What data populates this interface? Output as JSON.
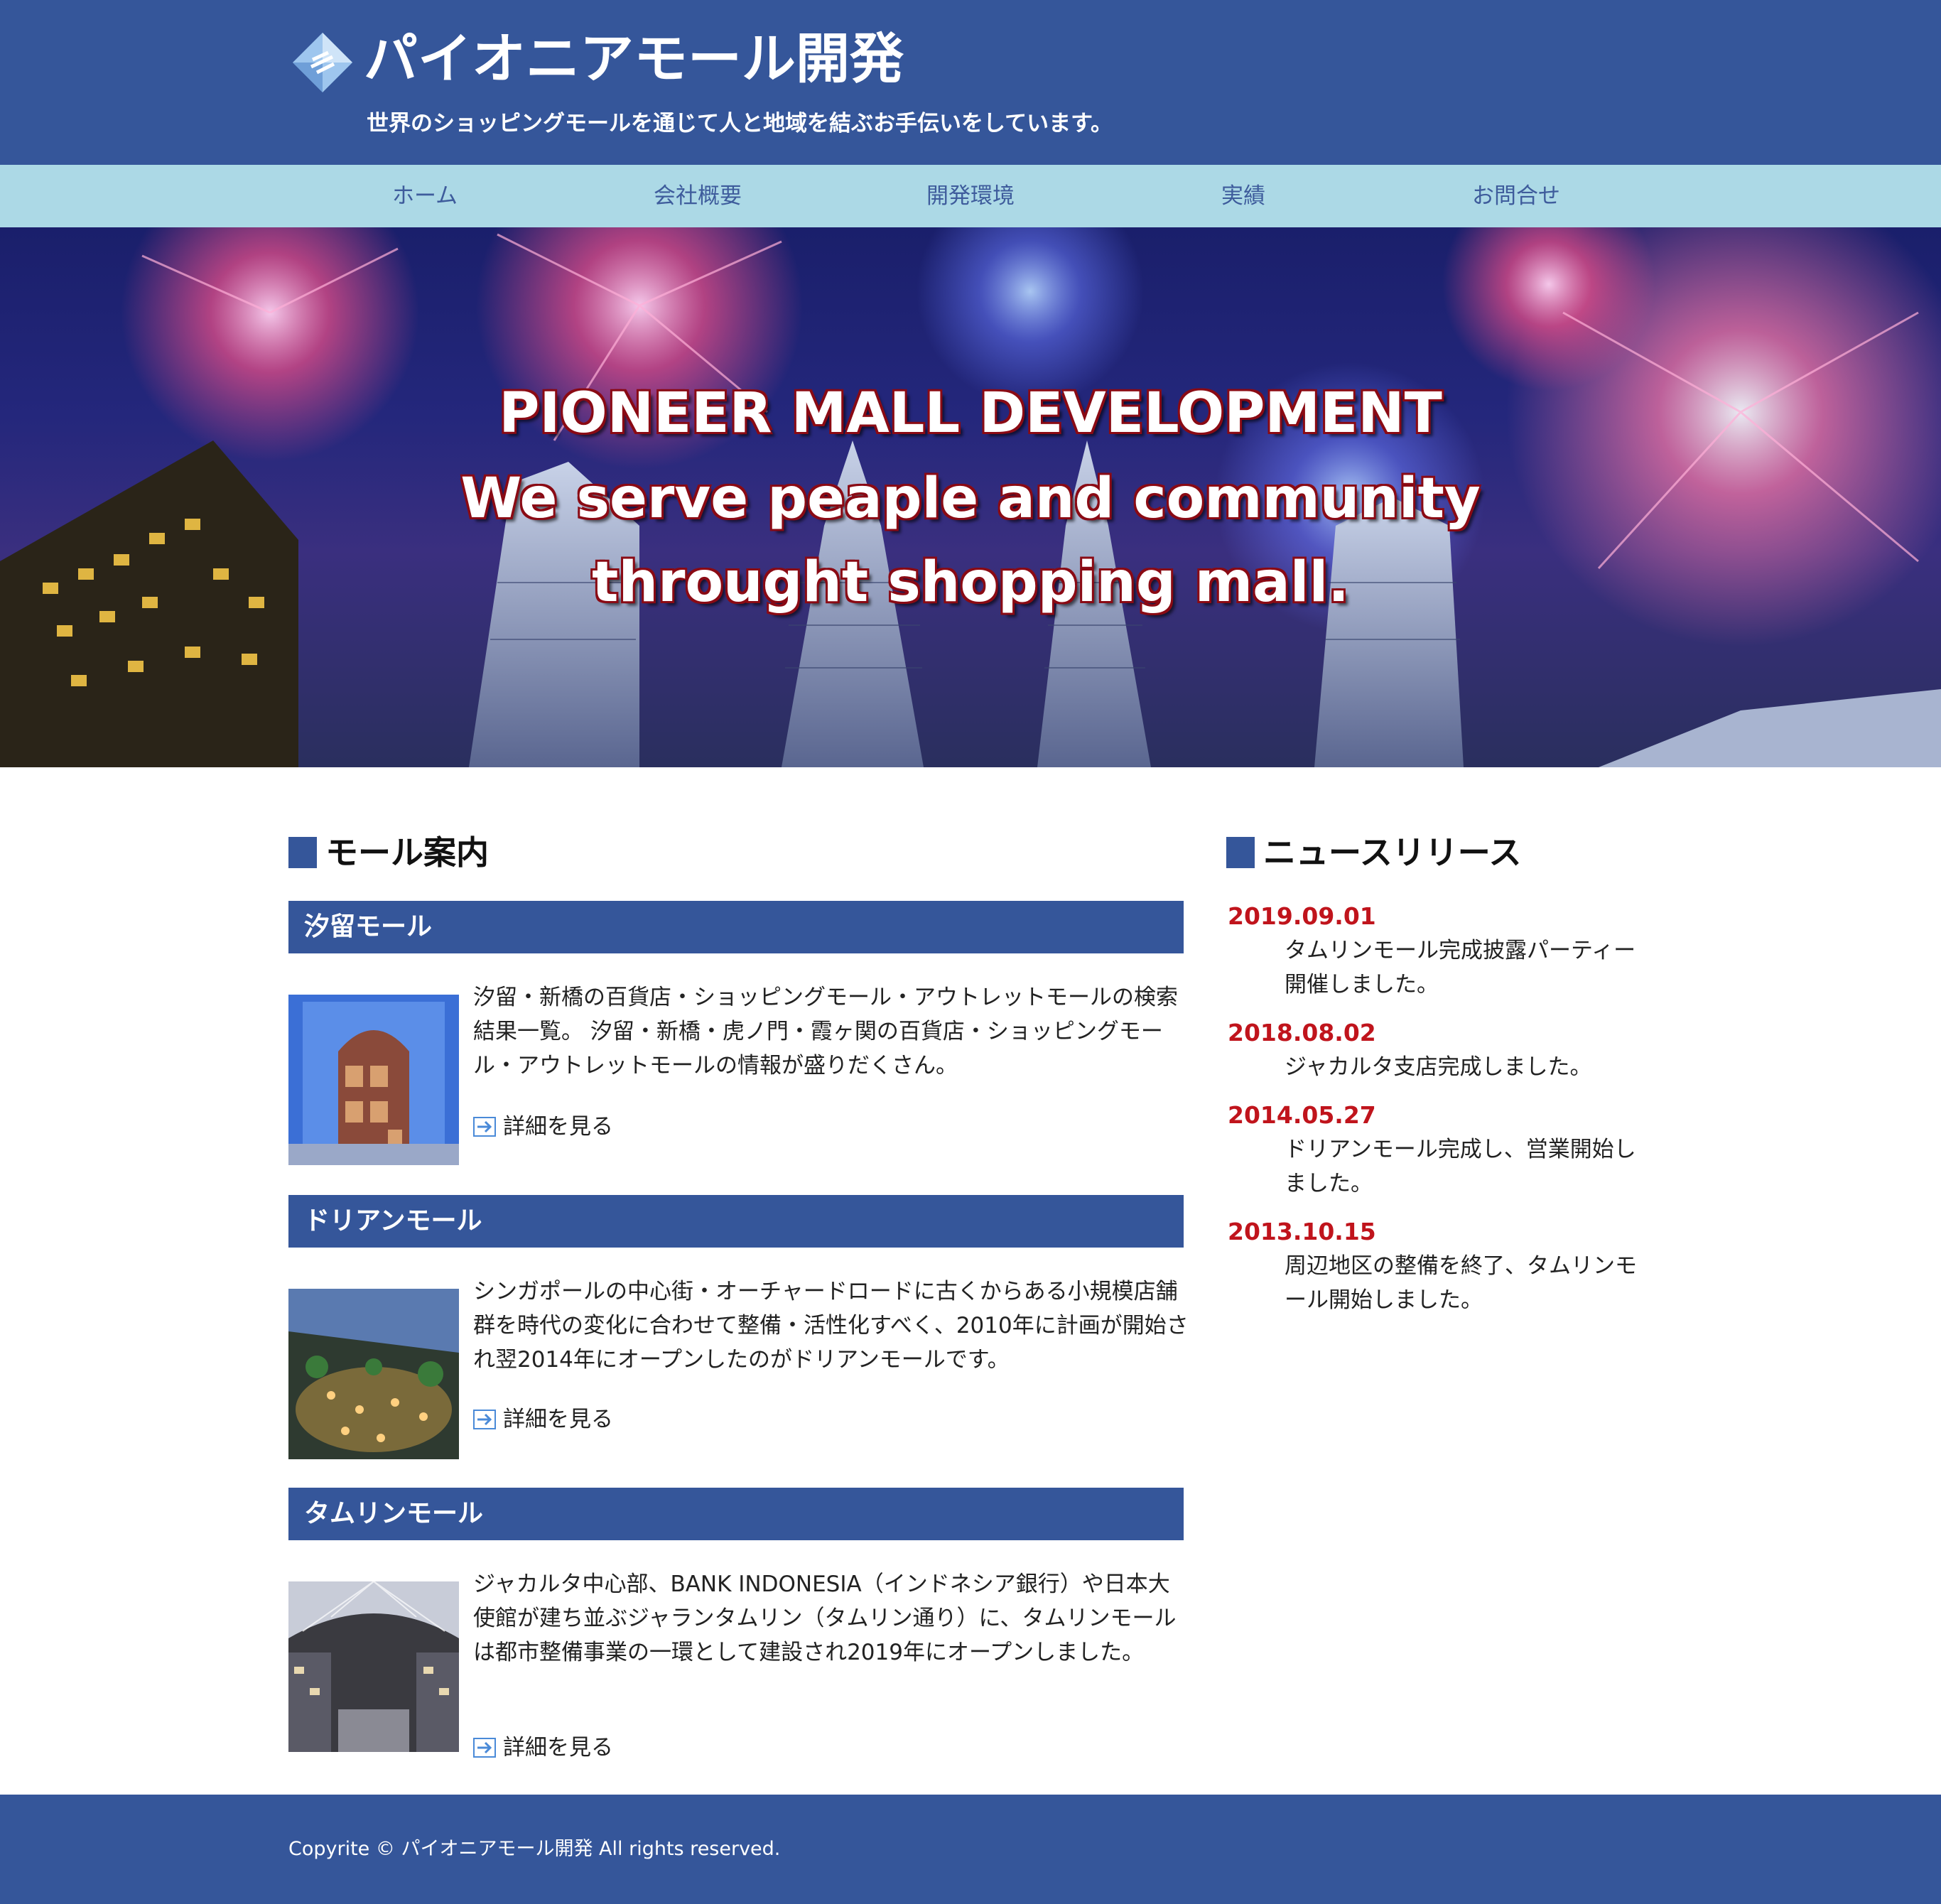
{
  "header": {
    "logo_icon": "diamond-logo-icon",
    "title": "パイオニアモール開発",
    "tagline": "世界のショッピングモールを通じて人と地域を結ぶお手伝いをしています。"
  },
  "nav": {
    "items": [
      {
        "label": "ホーム"
      },
      {
        "label": "会社概要"
      },
      {
        "label": "開発環境"
      },
      {
        "label": "実績"
      },
      {
        "label": "お問合せ"
      }
    ]
  },
  "hero": {
    "line1": "PIONEER MALL DEVELOPMENT",
    "line2": "We serve peaple and community",
    "line3": "throught shopping mall."
  },
  "malls": {
    "heading": "モール案内",
    "items": [
      {
        "name": "汐留モール",
        "description": "汐留・新橋の百貨店・ショッピングモール・アウトレットモールの検索結果一覧。 汐留・新橋・虎ノ門・霞ヶ関の百貨店・ショッピングモール・アウトレットモールの情報が盛りだくさん。",
        "link": "詳細を見る"
      },
      {
        "name": "ドリアンモール",
        "description": "シンガポールの中心街・オーチャードロードに古くからある小規模店舗群を時代の変化に合わせて整備・活性化すべく、2010年に計画が開始され翌2014年にオープンしたのがドリアンモールです。",
        "link": "詳細を見る"
      },
      {
        "name": "タムリンモール",
        "description": "ジャカルタ中心部、BANK INDONESIA（インドネシア銀行）や日本大使館が建ち並ぶジャランタムリン（タムリン通り）に、タムリンモールは都市整備事業の一環として建設され2019年にオープンしました。",
        "link": "詳細を見る"
      }
    ]
  },
  "news": {
    "heading": "ニュースリリース",
    "items": [
      {
        "date": "2019.09.01",
        "text": "タムリンモール完成披露パーティー開催しました。"
      },
      {
        "date": "2018.08.02",
        "text": "ジャカルタ支店完成しました。"
      },
      {
        "date": "2014.05.27",
        "text": "ドリアンモール完成し、営業開始しました。"
      },
      {
        "date": "2013.10.15",
        "text": "周辺地区の整備を終了、タムリンモール開始しました。"
      }
    ]
  },
  "footer": {
    "copyright": "Copyrite © パイオニアモール開発 All rights reserved."
  },
  "colors": {
    "brand_blue": "#35569a",
    "nav_bg": "#acd9e6",
    "nav_text": "#3e5c9c",
    "news_date": "#c0141c"
  }
}
